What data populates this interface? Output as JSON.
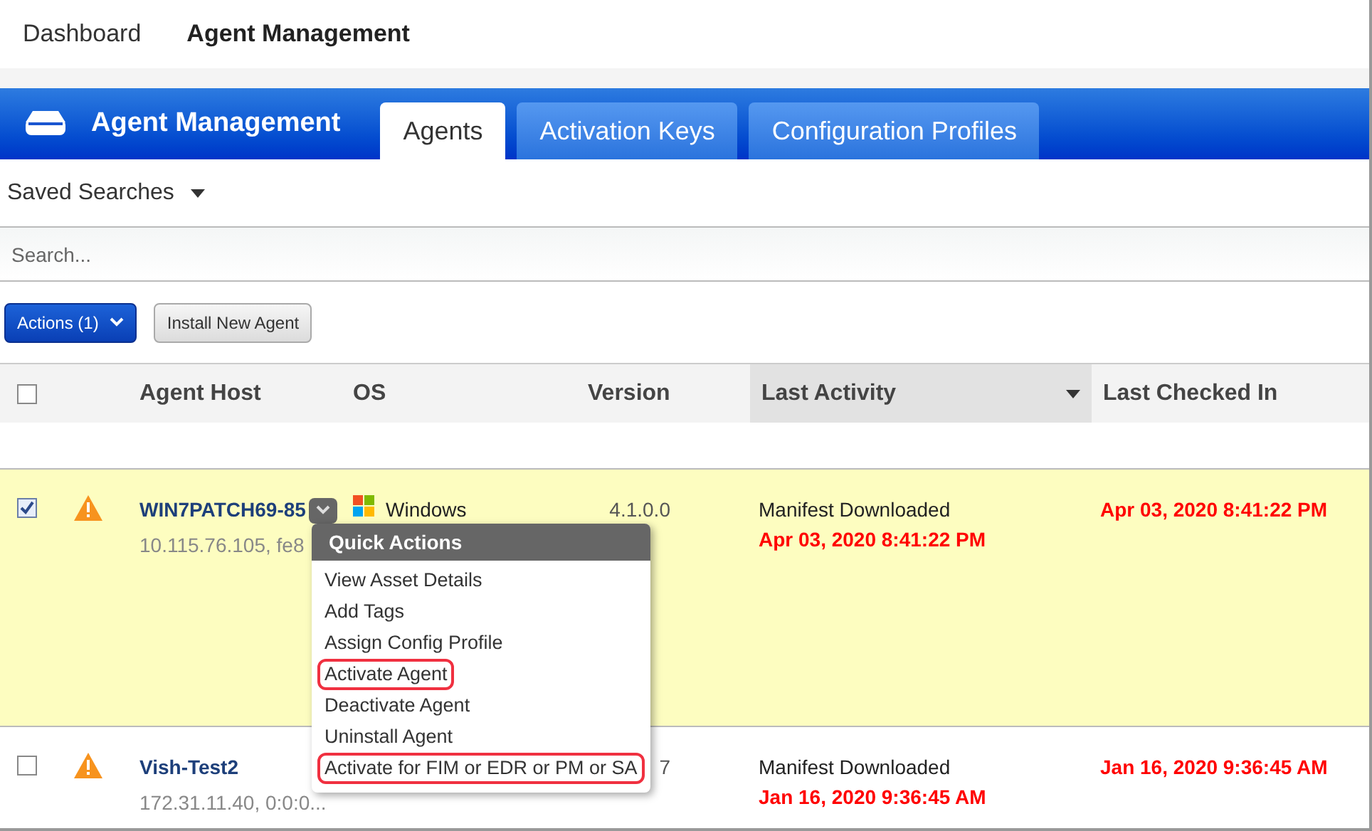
{
  "top_nav": [
    {
      "label": "Dashboard",
      "selected": false
    },
    {
      "label": "Agent Management",
      "selected": true
    }
  ],
  "header": {
    "title": "Agent Management"
  },
  "tabs": [
    {
      "label": "Agents",
      "selected": true
    },
    {
      "label": "Activation Keys",
      "selected": false
    },
    {
      "label": "Configuration Profiles",
      "selected": false
    }
  ],
  "saved_searches": "Saved Searches",
  "search": {
    "placeholder": "Search..."
  },
  "toolbar": {
    "actions": "Actions (1)",
    "install": "Install New Agent"
  },
  "table": {
    "select_all": {
      "checked": false
    },
    "columns": [
      {
        "label": "Agent Host",
        "sorted": false
      },
      {
        "label": "OS",
        "sorted": false
      },
      {
        "label": "Version",
        "sorted": false
      },
      {
        "label": "Last Activity",
        "sorted": true
      },
      {
        "label": "Last Checked In",
        "sorted": false
      }
    ],
    "rows": [
      {
        "checked": true,
        "host": "WIN7PATCH69-85",
        "address": "10.115.76.105, fe8",
        "os": "Windows",
        "version": "4.1.0.0",
        "activity": "Manifest Downloaded",
        "activity_time": "Apr 03, 2020 8:41:22 PM",
        "checked_in": "Apr 03, 2020 8:41:22 PM"
      },
      {
        "checked": false,
        "host": "Vish-Test2",
        "address": "172.31.11.40, 0:0:0...",
        "version": "7",
        "activity": "Manifest Downloaded",
        "activity_time": "Jan 16, 2020 9:36:45 AM",
        "checked_in": "Jan 16, 2020 9:36:45 AM"
      }
    ]
  },
  "quick_actions": {
    "title": "Quick Actions",
    "items": [
      {
        "label": "View Asset Details",
        "highlighted": false
      },
      {
        "label": "Add Tags",
        "highlighted": false
      },
      {
        "label": "Assign Config Profile",
        "highlighted": false
      },
      {
        "label": "Activate Agent",
        "highlighted": true
      },
      {
        "label": "Deactivate Agent",
        "highlighted": false
      },
      {
        "label": "Uninstall Agent",
        "highlighted": false
      },
      {
        "label": "Activate for FIM or EDR or PM or SA",
        "highlighted": true
      }
    ]
  }
}
